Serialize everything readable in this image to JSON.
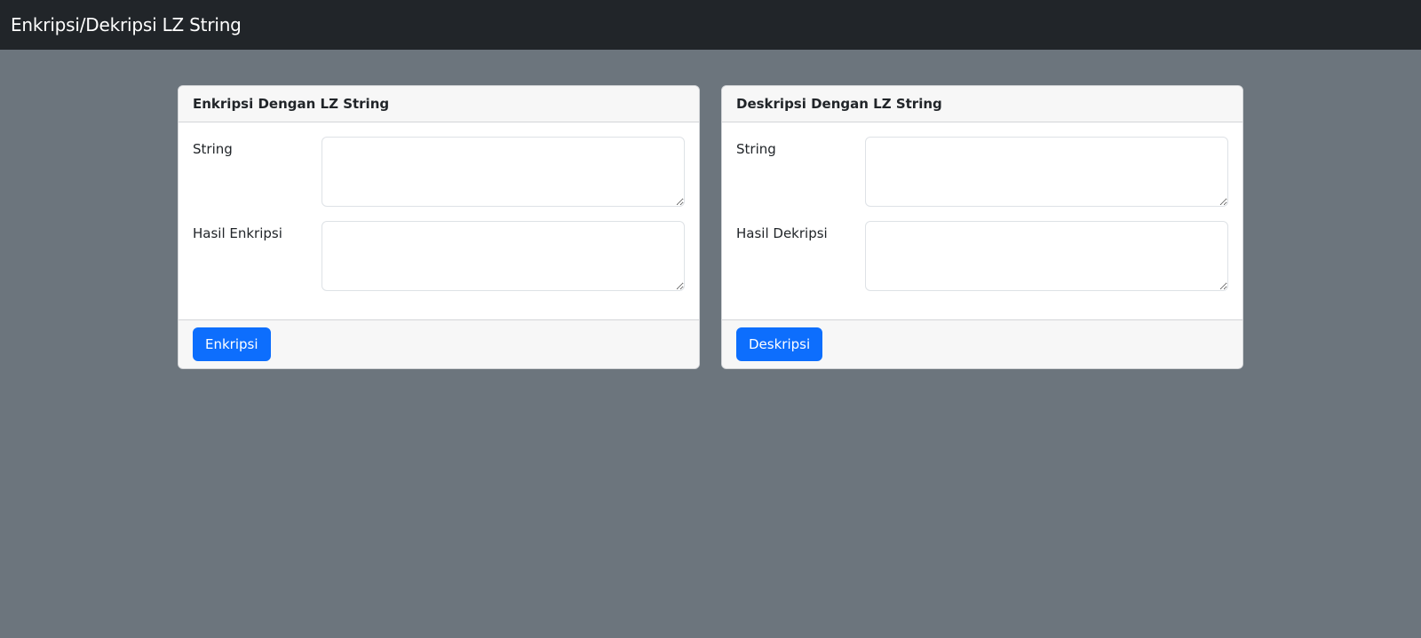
{
  "navbar": {
    "brand": "Enkripsi/Dekripsi LZ String"
  },
  "colors": {
    "navbar_bg": "#212529",
    "page_bg": "#6c757d",
    "primary_button": "#0d6efd"
  },
  "encrypt_card": {
    "title": "Enkripsi Dengan LZ String",
    "string_label": "String",
    "string_value": "",
    "result_label": "Hasil Enkripsi",
    "result_value": "",
    "button_label": "Enkripsi"
  },
  "decrypt_card": {
    "title": "Deskripsi Dengan LZ String",
    "string_label": "String",
    "string_value": "",
    "result_label": "Hasil Dekripsi",
    "result_value": "",
    "button_label": "Deskripsi"
  }
}
